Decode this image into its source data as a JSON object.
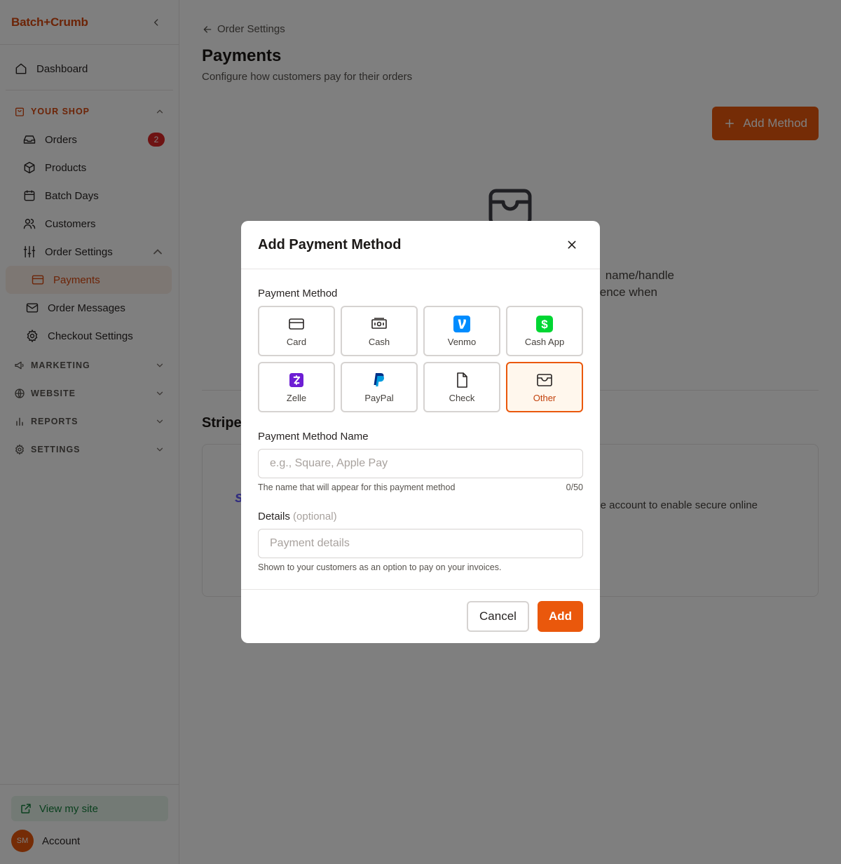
{
  "sidebar": {
    "brand": "Batch+Crumb",
    "dashboard": "Dashboard",
    "your_shop": {
      "title": "YOUR SHOP",
      "orders": "Orders",
      "orders_badge": "2",
      "products": "Products",
      "batch_days": "Batch Days",
      "customers": "Customers",
      "order_settings": "Order Settings",
      "payments": "Payments",
      "order_messages": "Order Messages",
      "checkout_settings": "Checkout Settings"
    },
    "sections": {
      "marketing": "MARKETING",
      "website": "WEBSITE",
      "reports": "REPORTS",
      "settings": "SETTINGS"
    },
    "footer": {
      "view_site": "View my site",
      "avatar_initials": "SM",
      "account": "Account"
    }
  },
  "main": {
    "breadcrumb": "Order Settings",
    "title": "Payments",
    "subtitle": "Configure how customers pay for their orders",
    "add_method_label": "Add Method",
    "empty_text_line1": "name/handle",
    "empty_text_line2": "ence when",
    "stripe_title": "Stripe",
    "stripe_logo": "s",
    "stripe_desc": "e account to enable secure online"
  },
  "modal": {
    "title": "Add Payment Method",
    "method_label": "Payment Method",
    "options": [
      {
        "label": "Card",
        "icon": "card-icon"
      },
      {
        "label": "Cash",
        "icon": "cash-icon"
      },
      {
        "label": "Venmo",
        "icon": "venmo-icon"
      },
      {
        "label": "Cash App",
        "icon": "cashapp-icon"
      },
      {
        "label": "Zelle",
        "icon": "zelle-icon"
      },
      {
        "label": "PayPal",
        "icon": "paypal-icon"
      },
      {
        "label": "Check",
        "icon": "check-icon"
      },
      {
        "label": "Other",
        "icon": "wallet-icon",
        "selected": true
      }
    ],
    "name_label": "Payment Method Name",
    "name_placeholder": "e.g., Square, Apple Pay",
    "name_value": "",
    "name_help": "The name that will appear for this payment method",
    "name_counter": "0/50",
    "details_label": "Details",
    "details_optional": "(optional)",
    "details_placeholder": "Payment details",
    "details_value": "",
    "details_help": "Shown to your customers as an option to pay on your invoices.",
    "cancel_label": "Cancel",
    "add_label": "Add"
  },
  "colors": {
    "accent": "#ea580c",
    "brand": "#d9480f",
    "venmo": "#008cff",
    "cashapp": "#00d632",
    "zelle": "#6d1ed4",
    "paypal": "#003087",
    "badge": "#dc2626",
    "stripe": "#635bff"
  }
}
